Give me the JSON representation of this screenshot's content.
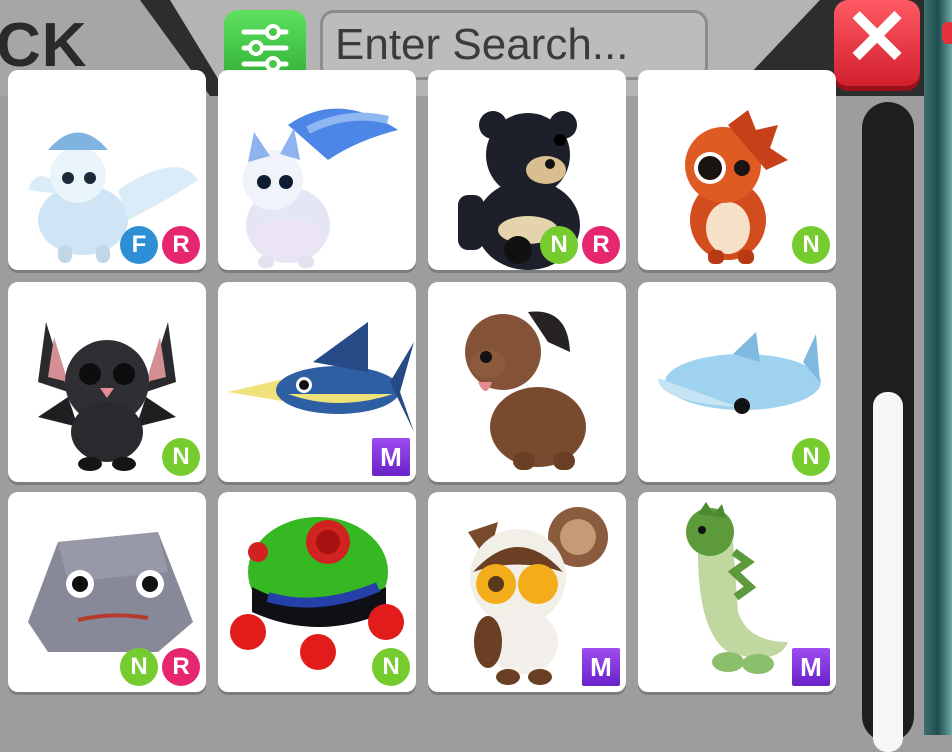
{
  "header": {
    "title": "CK",
    "search_placeholder": "Enter Search...",
    "close_label": "✕"
  },
  "pets": [
    {
      "name": "pegasus-pet",
      "badges": [
        "F",
        "R"
      ]
    },
    {
      "name": "arctic-fox-pet",
      "badges": []
    },
    {
      "name": "black-bear-pet",
      "badges": [
        "N",
        "R"
      ]
    },
    {
      "name": "orange-lizard-pet",
      "badges": [
        "N"
      ]
    },
    {
      "name": "bat-pet",
      "badges": [
        "N"
      ]
    },
    {
      "name": "swordfish-pet",
      "badges": [
        "M"
      ]
    },
    {
      "name": "dog-pet",
      "badges": []
    },
    {
      "name": "hammerhead-shark-pet",
      "badges": [
        "N"
      ]
    },
    {
      "name": "pet-rock-pet",
      "badges": [
        "N",
        "R"
      ]
    },
    {
      "name": "tree-frog-pet",
      "badges": [
        "N"
      ]
    },
    {
      "name": "owl-pet",
      "badges": [
        "M"
      ]
    },
    {
      "name": "sea-serpent-pet",
      "badges": [
        "M"
      ]
    }
  ],
  "colors": {
    "neon": "#76cc2e",
    "ride": "#e6266f",
    "fly": "#2e8fd6",
    "mega": "#7a2fd9",
    "close": "#e0303e",
    "filter": "#3ec040"
  }
}
